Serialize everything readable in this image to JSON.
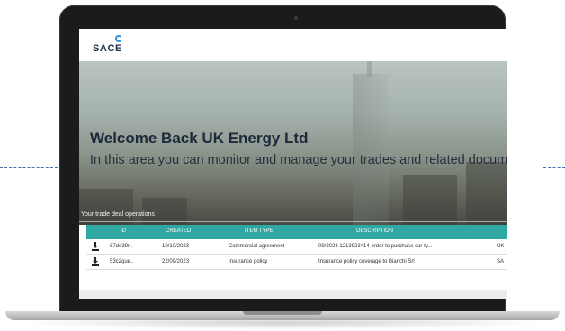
{
  "header": {
    "logo_text": "SACE"
  },
  "hero": {
    "title": "Welcome Back UK Energy Ltd",
    "subtitle": "In this area you can monitor and manage your trades and related docum",
    "section_label": "Your trade deal operations"
  },
  "table": {
    "columns": [
      "ID",
      "CREATED",
      "ITEM TYPE",
      "DESCRIPTION"
    ],
    "rows": [
      {
        "id": "87de39r..",
        "created": "10/10/2023",
        "item_type": "Commercial agreement",
        "description": "09/2023 1213923414 order to purchase car ty...",
        "extra": "UK"
      },
      {
        "id": "53c2que..",
        "created": "22/09/2023",
        "item_type": "Insurance policy",
        "description": "Insurance policy coverage to Bianchi Srl",
        "extra": "SA"
      }
    ]
  },
  "icons": {
    "download": "download-icon"
  },
  "colors": {
    "header_accent": "#2fa7a2",
    "logo": "#22324a",
    "dash": "#4a6fa5"
  }
}
